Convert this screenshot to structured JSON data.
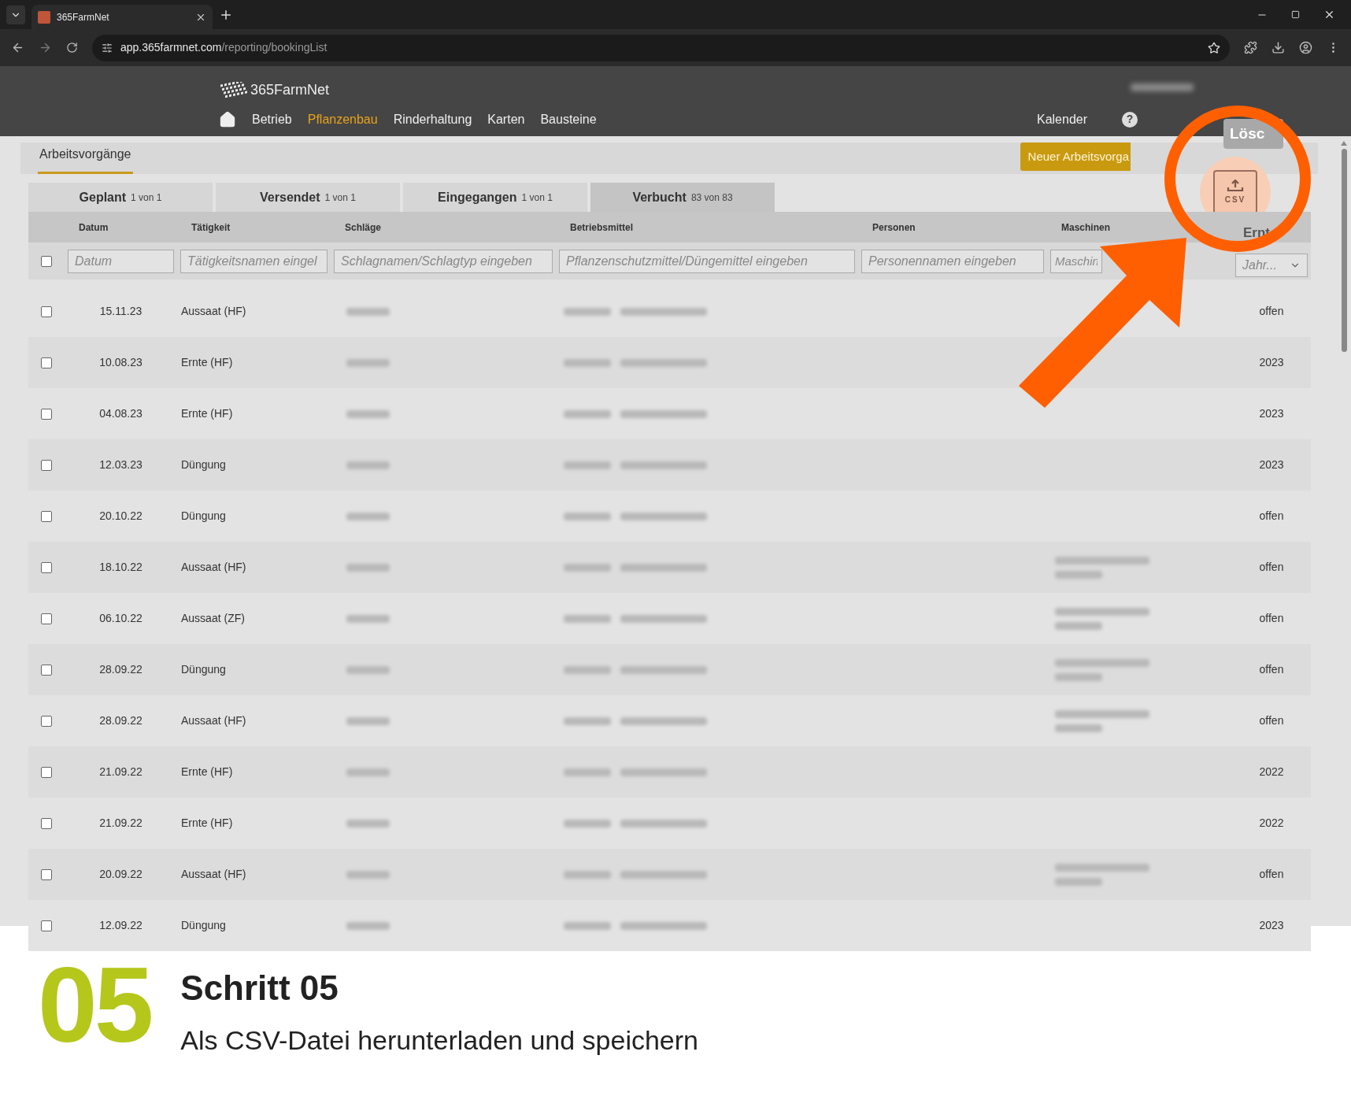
{
  "browser": {
    "tab_title": "365FarmNet",
    "url_host": "app.365farmnet.com",
    "url_path": "/reporting/bookingList"
  },
  "app": {
    "logo": "365FarmNet",
    "nav": [
      {
        "label": "Betrieb",
        "selected": false
      },
      {
        "label": "Pflanzenbau",
        "selected": true
      },
      {
        "label": "Rinderhaltung",
        "selected": false
      },
      {
        "label": "Karten",
        "selected": false
      },
      {
        "label": "Bausteine",
        "selected": false
      }
    ],
    "calendar": "Kalender",
    "help": "?"
  },
  "page": {
    "title": "Arbeitsvorgänge",
    "new_button": "Neuer Arbeitsvorga",
    "delete_button": "Lösc",
    "csv_label": "CSV"
  },
  "tabs": [
    {
      "label": "Geplant",
      "count": "1 von 1",
      "selected": false
    },
    {
      "label": "Versendet",
      "count": "1 von 1",
      "selected": false
    },
    {
      "label": "Eingegangen",
      "count": "1 von 1",
      "selected": false
    },
    {
      "label": "Verbucht",
      "count": "83 von 83",
      "selected": true
    }
  ],
  "table": {
    "columns": [
      "Datum",
      "Tätigkeit",
      "Schläge",
      "Betriebsmittel",
      "Personen",
      "Maschinen",
      "Ernt"
    ],
    "filters": [
      {
        "placeholder": "Datum"
      },
      {
        "placeholder": "Tätigkeitsnamen eingel"
      },
      {
        "placeholder": "Schlagnamen/Schlagtyp eingeben"
      },
      {
        "placeholder": "Pflanzenschutzmittel/Düngemittel eingeben"
      },
      {
        "placeholder": "Personennamen eingeben"
      },
      {
        "placeholder": "Maschin"
      }
    ],
    "harvest_select": "Jahr...",
    "select_all_checked": false,
    "rows": [
      {
        "date": "15.11.23",
        "activity": "Aussaat (HF)",
        "harvest": "offen",
        "checked": false,
        "machines_blurred": false
      },
      {
        "date": "10.08.23",
        "activity": "Ernte (HF)",
        "harvest": "2023",
        "checked": false,
        "machines_blurred": false
      },
      {
        "date": "04.08.23",
        "activity": "Ernte (HF)",
        "harvest": "2023",
        "checked": false,
        "machines_blurred": false
      },
      {
        "date": "12.03.23",
        "activity": "Düngung",
        "harvest": "2023",
        "checked": false,
        "machines_blurred": false
      },
      {
        "date": "20.10.22",
        "activity": "Düngung",
        "harvest": "offen",
        "checked": false,
        "machines_blurred": false
      },
      {
        "date": "18.10.22",
        "activity": "Aussaat (HF)",
        "harvest": "offen",
        "checked": false,
        "machines_blurred": true
      },
      {
        "date": "06.10.22",
        "activity": "Aussaat (ZF)",
        "harvest": "offen",
        "checked": false,
        "machines_blurred": true
      },
      {
        "date": "28.09.22",
        "activity": "Düngung",
        "harvest": "offen",
        "checked": false,
        "machines_blurred": true
      },
      {
        "date": "28.09.22",
        "activity": "Aussaat (HF)",
        "harvest": "offen",
        "checked": false,
        "machines_blurred": true
      },
      {
        "date": "21.09.22",
        "activity": "Ernte (HF)",
        "harvest": "2022",
        "checked": false,
        "machines_blurred": false
      },
      {
        "date": "21.09.22",
        "activity": "Ernte (HF)",
        "harvest": "2022",
        "checked": false,
        "machines_blurred": false
      },
      {
        "date": "20.09.22",
        "activity": "Aussaat (HF)",
        "harvest": "offen",
        "checked": false,
        "machines_blurred": true
      },
      {
        "date": "12.09.22",
        "activity": "Düngung",
        "harvest": "2023",
        "checked": false,
        "machines_blurred": false
      }
    ]
  },
  "step": {
    "number": "05",
    "title": "Schritt 05",
    "subtitle": "Als CSV-Datei herunterladen und speichern"
  }
}
